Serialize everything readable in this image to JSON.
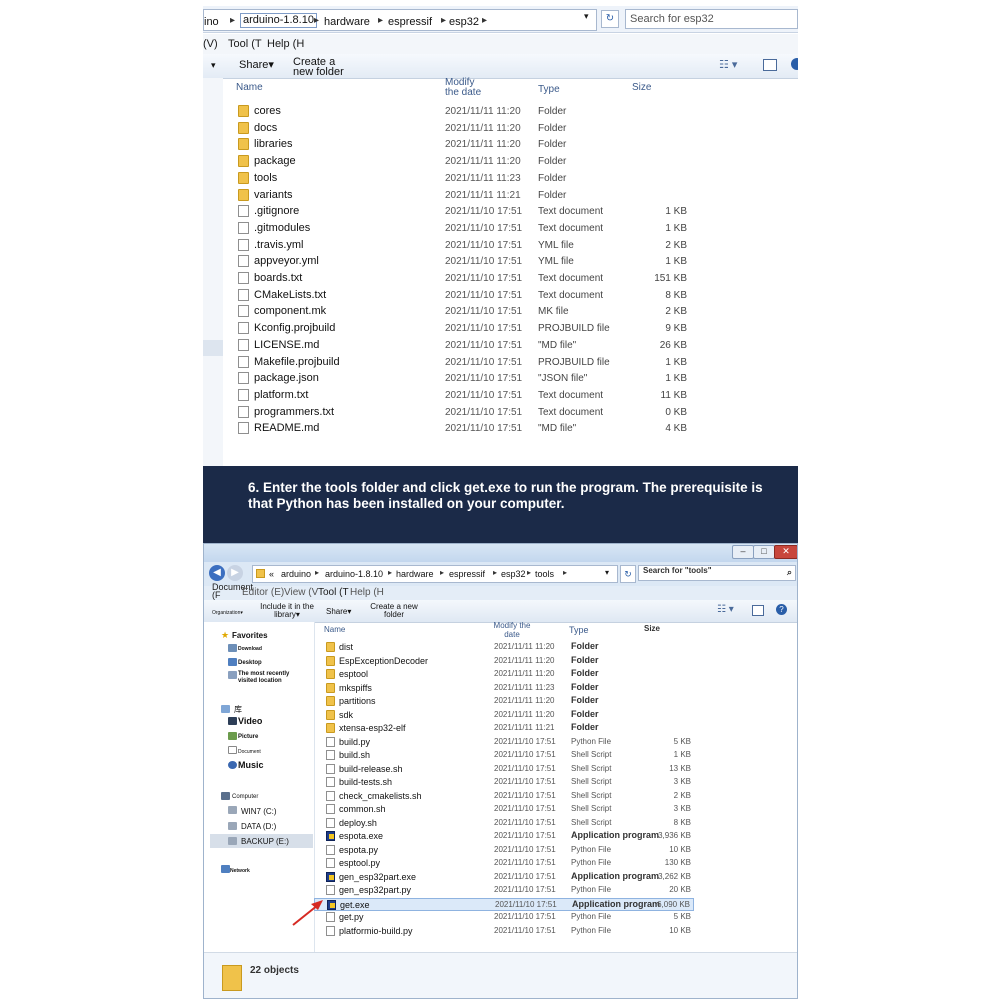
{
  "top_window": {
    "address_crumbs": [
      "ino",
      "arduino-1.8.10",
      "hardware",
      "espressif",
      "esp32"
    ],
    "search_placeholder": "Search for esp32",
    "menu": [
      "(V)",
      "Tool (T",
      "Help (H"
    ],
    "toolbar": {
      "share": "Share",
      "new_folder": "Create a new folder"
    },
    "columns": {
      "name": "Name",
      "date": "Modify the date",
      "type": "Type",
      "size": "Size"
    },
    "files": [
      {
        "name": "cores",
        "date": "2021/11/11 11:20",
        "type": "Folder",
        "size": "",
        "icon": "folder"
      },
      {
        "name": "docs",
        "date": "2021/11/11 11:20",
        "type": "Folder",
        "size": "",
        "icon": "folder"
      },
      {
        "name": "libraries",
        "date": "2021/11/11 11:20",
        "type": "Folder",
        "size": "",
        "icon": "folder"
      },
      {
        "name": "package",
        "date": "2021/11/11 11:20",
        "type": "Folder",
        "size": "",
        "icon": "folder"
      },
      {
        "name": "tools",
        "date": "2021/11/11 11:23",
        "type": "Folder",
        "size": "",
        "icon": "folder"
      },
      {
        "name": "variants",
        "date": "2021/11/11 11:21",
        "type": "Folder",
        "size": "",
        "icon": "folder"
      },
      {
        "name": ".gitignore",
        "date": "2021/11/10 17:51",
        "type": "Text document",
        "size": "1 KB",
        "icon": "doc"
      },
      {
        "name": ".gitmodules",
        "date": "2021/11/10 17:51",
        "type": "Text document",
        "size": "1 KB",
        "icon": "doc"
      },
      {
        "name": ".travis.yml",
        "date": "2021/11/10 17:51",
        "type": "YML file",
        "size": "2 KB",
        "icon": "doc"
      },
      {
        "name": "appveyor.yml",
        "date": "2021/11/10 17:51",
        "type": "YML file",
        "size": "1 KB",
        "icon": "doc"
      },
      {
        "name": "boards.txt",
        "date": "2021/11/10 17:51",
        "type": "Text document",
        "size": "151 KB",
        "icon": "doc"
      },
      {
        "name": "CMakeLists.txt",
        "date": "2021/11/10 17:51",
        "type": "Text document",
        "size": "8 KB",
        "icon": "doc"
      },
      {
        "name": "component.mk",
        "date": "2021/11/10 17:51",
        "type": "MK file",
        "size": "2 KB",
        "icon": "doc"
      },
      {
        "name": "Kconfig.projbuild",
        "date": "2021/11/10 17:51",
        "type": "PROJBUILD file",
        "size": "9 KB",
        "icon": "doc"
      },
      {
        "name": "LICENSE.md",
        "date": "2021/11/10 17:51",
        "type": "\"MD file\"",
        "size": "26 KB",
        "icon": "doc"
      },
      {
        "name": "Makefile.projbuild",
        "date": "2021/11/10 17:51",
        "type": "PROJBUILD file",
        "size": "1 KB",
        "icon": "doc"
      },
      {
        "name": "package.json",
        "date": "2021/11/10 17:51",
        "type": "\"JSON file\"",
        "size": "1 KB",
        "icon": "doc"
      },
      {
        "name": "platform.txt",
        "date": "2021/11/10 17:51",
        "type": "Text document",
        "size": "11 KB",
        "icon": "doc"
      },
      {
        "name": "programmers.txt",
        "date": "2021/11/10 17:51",
        "type": "Text document",
        "size": "0 KB",
        "icon": "doc"
      },
      {
        "name": "README.md",
        "date": "2021/11/10 17:51",
        "type": "\"MD file\"",
        "size": "4 KB",
        "icon": "doc"
      }
    ]
  },
  "banner": {
    "text": "6. Enter the tools folder and click get.exe to run the program. The prerequisite is that Python has been installed on your computer."
  },
  "bottom_window": {
    "address_crumbs": [
      "«",
      "arduino",
      "arduino-1.8.10",
      "hardware",
      "espressif",
      "esp32",
      "tools"
    ],
    "search_placeholder": "Search for \"tools\"",
    "menu": [
      "Document (F",
      "Editor (E)",
      "View (V",
      "Tool (T",
      "Help (H"
    ],
    "toolbar": {
      "organize": "Organization",
      "include": "Include it in the library",
      "share": "Share",
      "new_folder": "Create a new folder"
    },
    "columns": {
      "name": "Name",
      "date": "Modify the date",
      "type": "Type",
      "size": "Size"
    },
    "nav": {
      "favorites": "Favorites",
      "download": "Download",
      "desktop": "Desktop",
      "recent": "The most recently visited location",
      "library": "库",
      "video": "Video",
      "picture": "Picture",
      "document": "Document",
      "music": "Music",
      "computer": "Computer",
      "drive_c": "WIN7 (C:)",
      "drive_d": "DATA (D:)",
      "drive_e": "BACKUP (E:)",
      "network": "Network"
    },
    "files": [
      {
        "name": "dist",
        "date": "2021/11/11 11:20",
        "type": "Folder",
        "size": "",
        "icon": "folder"
      },
      {
        "name": "EspExceptionDecoder",
        "date": "2021/11/11 11:20",
        "type": "Folder",
        "size": "",
        "icon": "folder"
      },
      {
        "name": "esptool",
        "date": "2021/11/11 11:20",
        "type": "Folder",
        "size": "",
        "icon": "folder"
      },
      {
        "name": "mkspiffs",
        "date": "2021/11/11 11:23",
        "type": "Folder",
        "size": "",
        "icon": "folder"
      },
      {
        "name": "partitions",
        "date": "2021/11/11 11:20",
        "type": "Folder",
        "size": "",
        "icon": "folder"
      },
      {
        "name": "sdk",
        "date": "2021/11/11 11:20",
        "type": "Folder",
        "size": "",
        "icon": "folder"
      },
      {
        "name": "xtensa-esp32-elf",
        "date": "2021/11/11 11:21",
        "type": "Folder",
        "size": "",
        "icon": "folder"
      },
      {
        "name": "build.py",
        "date": "2021/11/10 17:51",
        "type": "Python File",
        "size": "5 KB",
        "icon": "doc"
      },
      {
        "name": "build.sh",
        "date": "2021/11/10 17:51",
        "type": "Shell Script",
        "size": "1 KB",
        "icon": "doc"
      },
      {
        "name": "build-release.sh",
        "date": "2021/11/10 17:51",
        "type": "Shell Script",
        "size": "13 KB",
        "icon": "doc"
      },
      {
        "name": "build-tests.sh",
        "date": "2021/11/10 17:51",
        "type": "Shell Script",
        "size": "3 KB",
        "icon": "doc"
      },
      {
        "name": "check_cmakelists.sh",
        "date": "2021/11/10 17:51",
        "type": "Shell Script",
        "size": "2 KB",
        "icon": "doc"
      },
      {
        "name": "common.sh",
        "date": "2021/11/10 17:51",
        "type": "Shell Script",
        "size": "3 KB",
        "icon": "doc"
      },
      {
        "name": "deploy.sh",
        "date": "2021/11/10 17:51",
        "type": "Shell Script",
        "size": "8 KB",
        "icon": "doc"
      },
      {
        "name": "espota.exe",
        "date": "2021/11/10 17:51",
        "type": "Application program",
        "size": "3,936 KB",
        "icon": "exe"
      },
      {
        "name": "espota.py",
        "date": "2021/11/10 17:51",
        "type": "Python File",
        "size": "10 KB",
        "icon": "doc"
      },
      {
        "name": "esptool.py",
        "date": "2021/11/10 17:51",
        "type": "Python File",
        "size": "130 KB",
        "icon": "doc"
      },
      {
        "name": "gen_esp32part.exe",
        "date": "2021/11/10 17:51",
        "type": "Application program",
        "size": "3,262 KB",
        "icon": "exe"
      },
      {
        "name": "gen_esp32part.py",
        "date": "2021/11/10 17:51",
        "type": "Python File",
        "size": "20 KB",
        "icon": "doc"
      },
      {
        "name": "get.exe",
        "date": "2021/11/10 17:51",
        "type": "Application program",
        "size": "6,090 KB",
        "icon": "exe",
        "selected": true
      },
      {
        "name": "get.py",
        "date": "2021/11/10 17:51",
        "type": "Python File",
        "size": "5 KB",
        "icon": "doc"
      },
      {
        "name": "platformio-build.py",
        "date": "2021/11/10 17:51",
        "type": "Python File",
        "size": "10 KB",
        "icon": "doc"
      }
    ],
    "status": "22 objects"
  }
}
